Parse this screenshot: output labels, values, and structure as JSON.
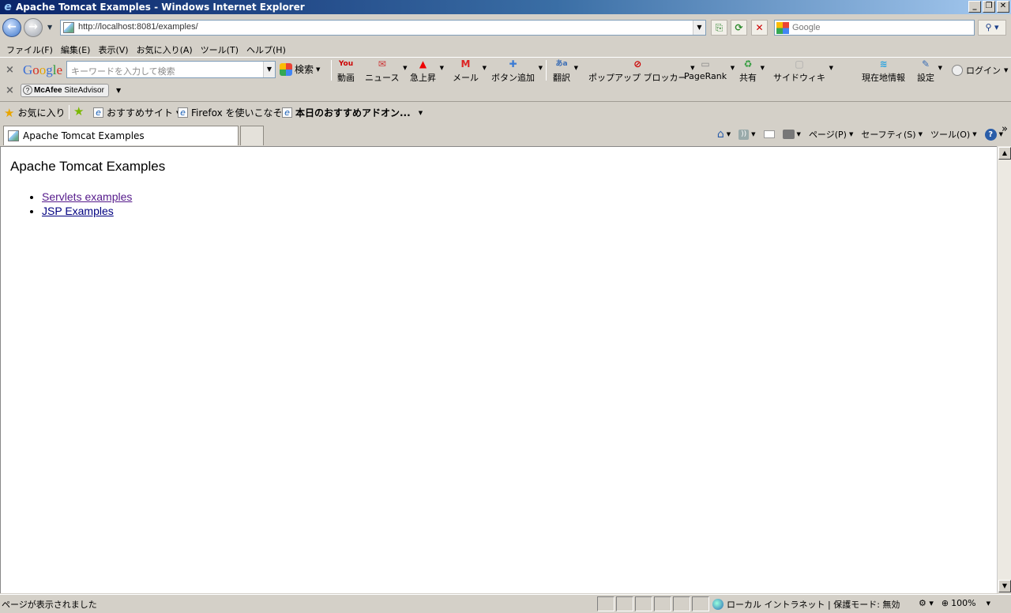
{
  "window": {
    "title": "Apache Tomcat Examples - Windows Internet Explorer",
    "buttons": [
      "_",
      "❐",
      "✕"
    ]
  },
  "address_bar": {
    "url": "http://localhost:8081/examples/",
    "search_placeholder": "Google"
  },
  "menu": [
    "ファイル(F)",
    "編集(E)",
    "表示(V)",
    "お気に入り(A)",
    "ツール(T)",
    "ヘルプ(H)"
  ],
  "google_toolbar": {
    "close": "×",
    "logo": [
      "G",
      "o",
      "o",
      "g",
      "l",
      "e"
    ],
    "search_placeholder": "キーワードを入力して検索",
    "search_label": "検索",
    "tools": [
      {
        "icon": "You",
        "label": "動画"
      },
      {
        "icon": "✉",
        "label": "ニュース"
      },
      {
        "icon": "▲",
        "label": "急上昇"
      },
      {
        "icon": "M",
        "label": "メール"
      },
      {
        "icon": "✚",
        "label": "ボタン追加"
      },
      {
        "icon": "あa",
        "label": "翻訳"
      },
      {
        "icon": "⊘",
        "label": "ポップアップ ブロッカー"
      },
      {
        "icon": "▭",
        "label": "PageRank"
      },
      {
        "icon": "♻",
        "label": "共有"
      },
      {
        "icon": "▢",
        "label": "サイドウィキ"
      },
      {
        "icon": "≋",
        "label": "現在地情報"
      },
      {
        "icon": "✎",
        "label": "設定"
      }
    ],
    "login": "ログイン"
  },
  "mcafee": {
    "close": "×",
    "brand": "McAfee",
    "product": "SiteAdvisor"
  },
  "favorites_bar": {
    "favorites_label": "お気に入り",
    "links": [
      "おすすめサイト",
      "Firefox を使いこなそう",
      "本日のおすすめアドオン..."
    ]
  },
  "tab": {
    "title": "Apache Tomcat Examples"
  },
  "command_bar": {
    "page": "ページ(P)",
    "safety": "セーフティ(S)",
    "tools": "ツール(O)",
    "help": "?",
    "more": "»"
  },
  "content": {
    "heading": "Apache Tomcat Examples",
    "links": [
      "Servlets examples",
      "JSP Examples"
    ]
  },
  "status_bar": {
    "text": "ページが表示されました",
    "zone": "ローカル イントラネット | 保護モード: 無効",
    "zoom": "100%"
  },
  "colors": {
    "title_bar": "#0a246a",
    "link": "#000080",
    "visited_link": "#551a8b"
  }
}
